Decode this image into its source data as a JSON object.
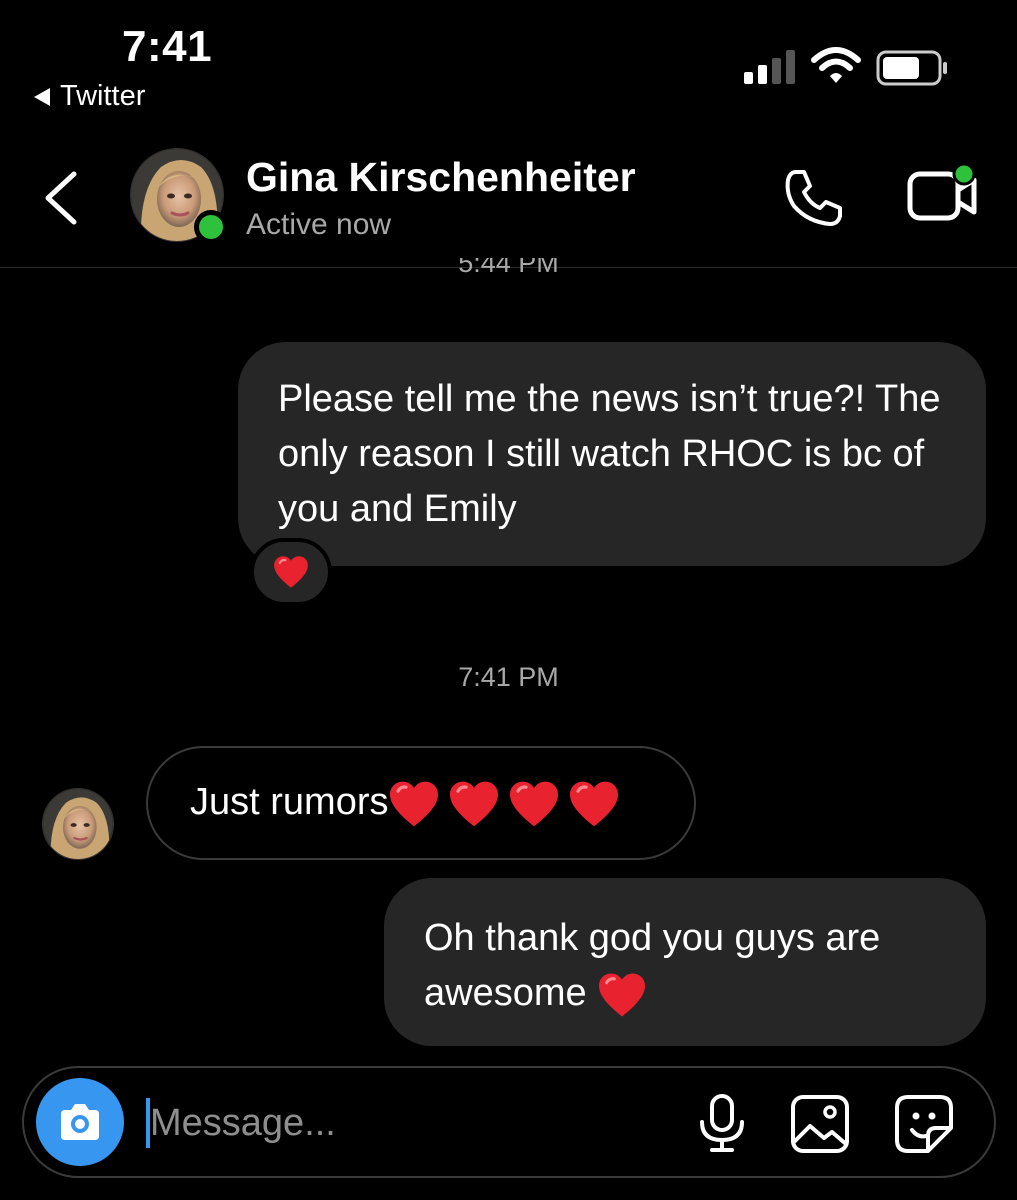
{
  "status_bar": {
    "time": "7:41",
    "back_app": "Twitter"
  },
  "header": {
    "name": "Gina Kirschenheiter",
    "status": "Active now"
  },
  "messages": {
    "timestamp_1": "5:44 PM",
    "outgoing_1": "Please tell me the news isn’t true?! The only reason I still watch RHOC is bc of you and Emily",
    "timestamp_2": "7:41 PM",
    "incoming_1": "Just rumors",
    "outgoing_2": "Oh thank god you guys are awesome "
  },
  "icons": {
    "reaction": "heart-icon",
    "call": "phone-icon",
    "video": "video-camera-icon",
    "camera": "camera-icon",
    "mic": "microphone-icon",
    "gallery": "image-icon",
    "sticker": "sticker-icon"
  },
  "composer": {
    "placeholder": "Message..."
  },
  "colors": {
    "accent": "#3797f0",
    "online": "#2ec13b",
    "bubble": "#262626",
    "heart": "#e8222f"
  }
}
